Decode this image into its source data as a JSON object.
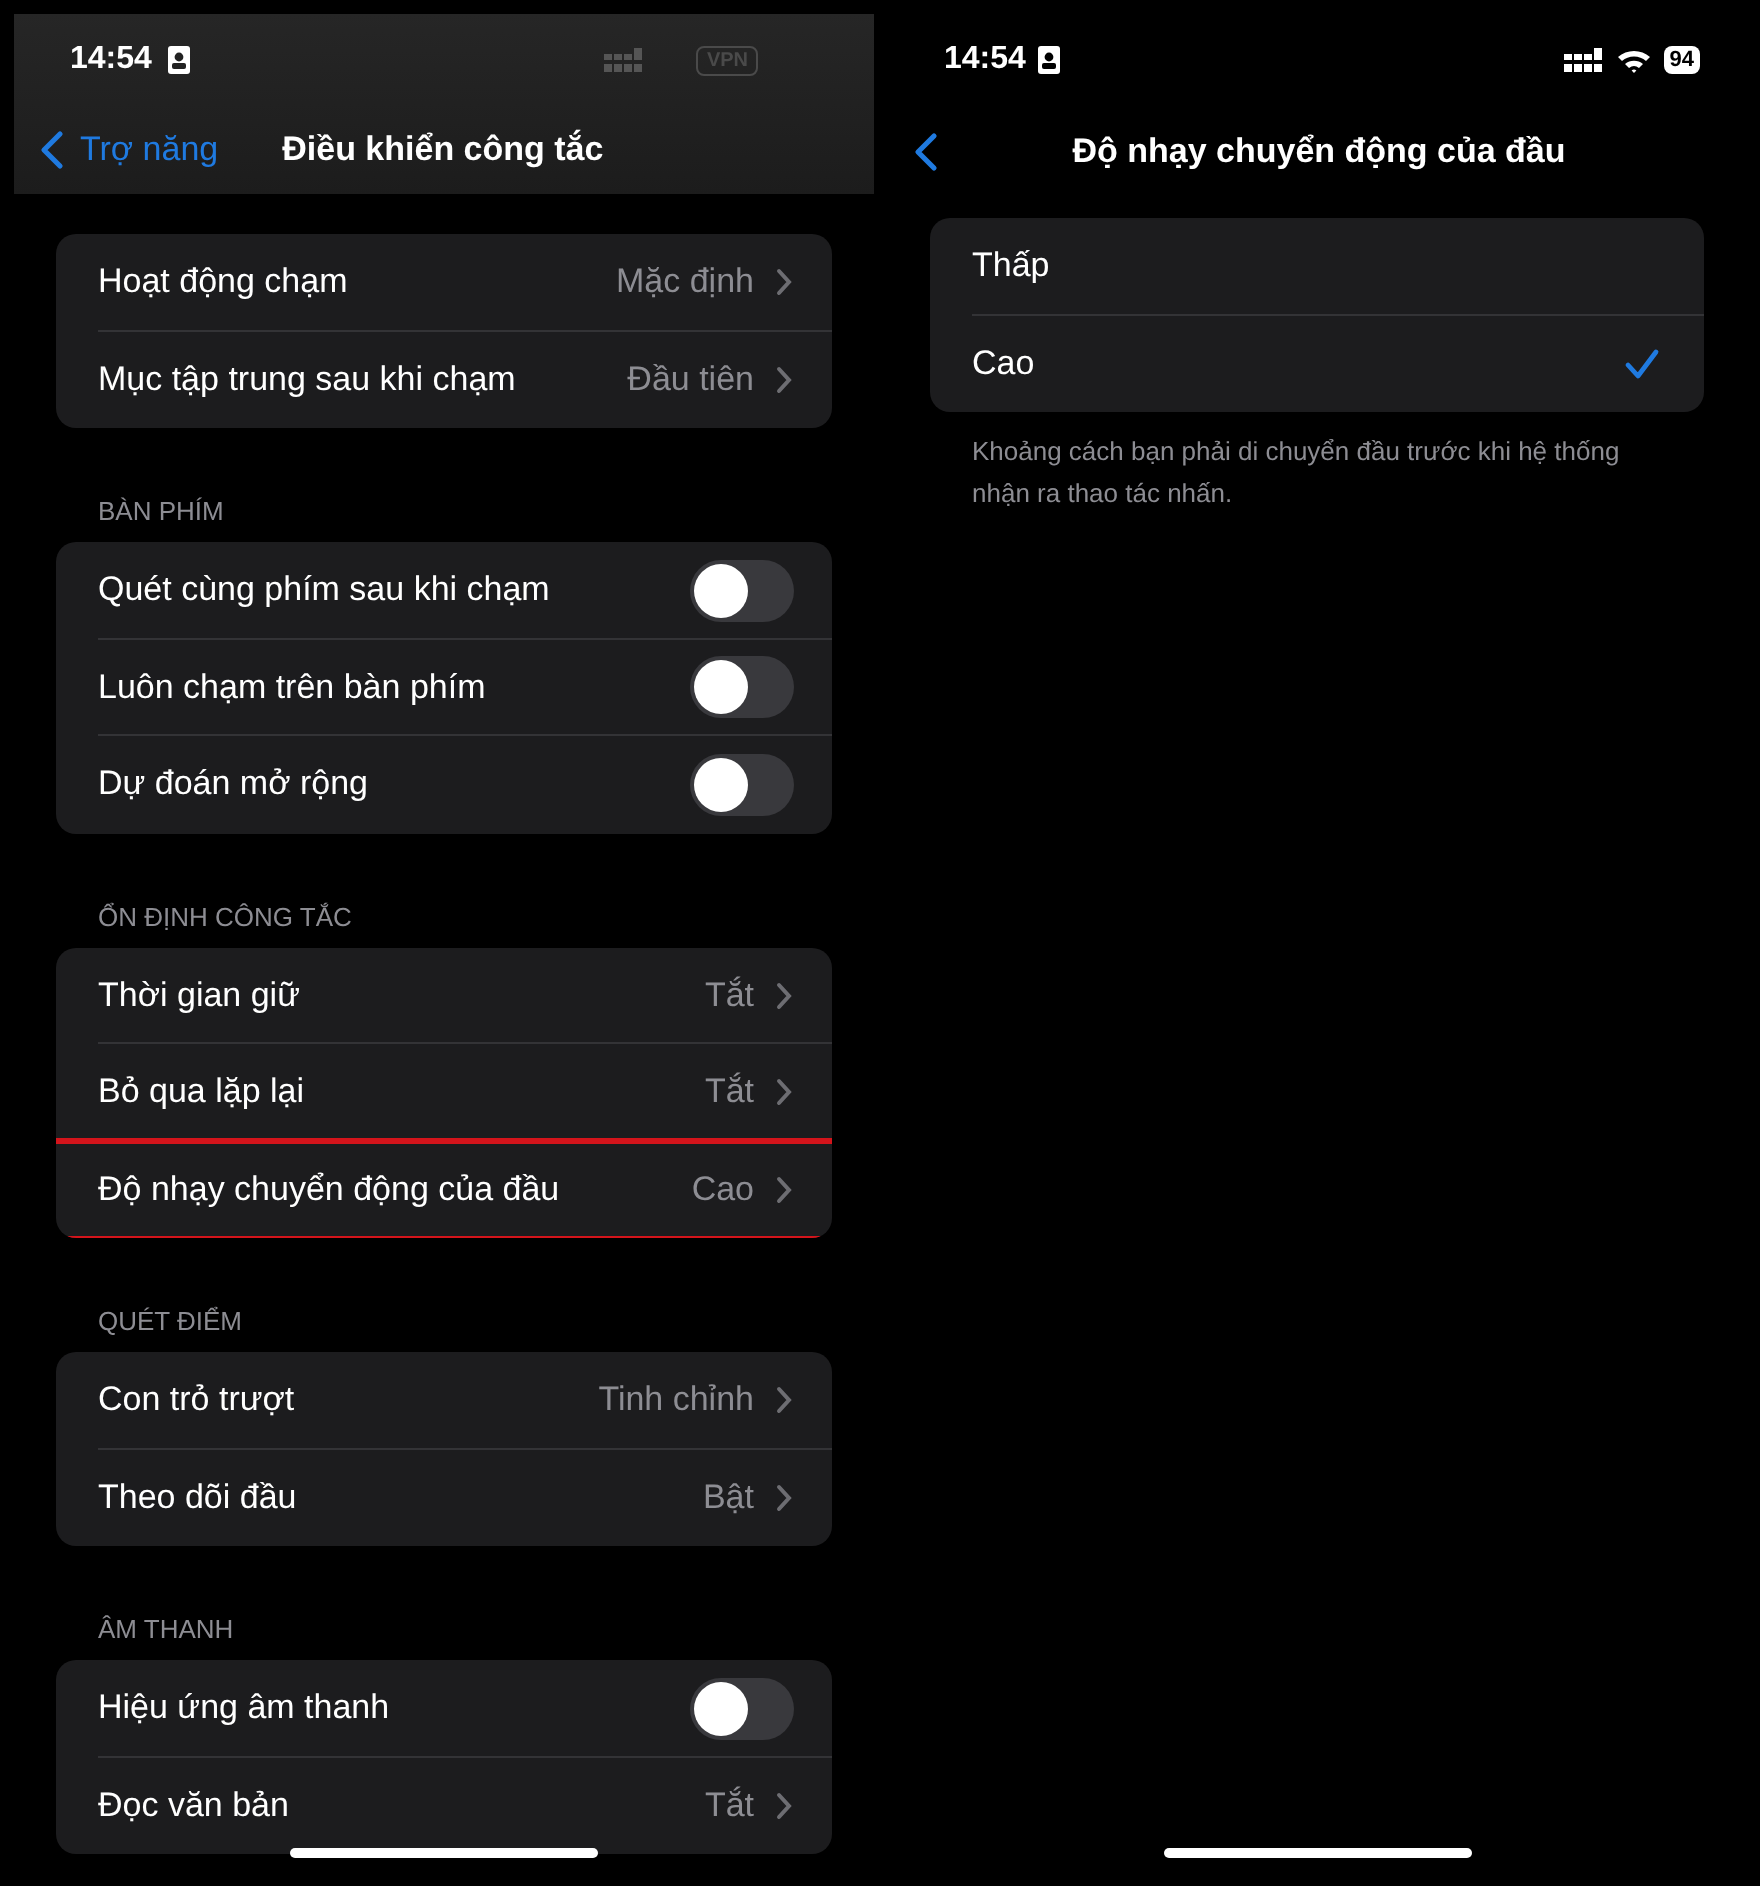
{
  "left": {
    "status_bar": {
      "time": "14:54",
      "vpn": "VPN"
    },
    "nav": {
      "back_label": "Trợ năng",
      "title": "Điều khiển công tắc"
    },
    "sections": [
      {
        "rows": [
          {
            "kind": "value",
            "label": "Hoạt động chạm",
            "value": "Mặc định",
            "highlighted": false
          },
          {
            "kind": "value",
            "label": "Mục tập trung sau khi chạm",
            "value": "Đầu tiên",
            "highlighted": false
          }
        ]
      },
      {
        "header": "BÀN PHÍM",
        "rows": [
          {
            "kind": "toggle",
            "label": "Quét cùng phím sau khi chạm",
            "on": false,
            "highlighted": false
          },
          {
            "kind": "toggle",
            "label": "Luôn chạm trên bàn phím",
            "on": false,
            "highlighted": false
          },
          {
            "kind": "toggle",
            "label": "Dự đoán mở rộng",
            "on": false,
            "highlighted": false
          }
        ]
      },
      {
        "header": "ỔN ĐỊNH CÔNG TẮC",
        "rows": [
          {
            "kind": "value",
            "label": "Thời gian giữ",
            "value": "Tắt",
            "highlighted": false
          },
          {
            "kind": "value",
            "label": "Bỏ qua lặp lại",
            "value": "Tắt",
            "highlighted": false
          },
          {
            "kind": "value",
            "label": "Độ nhạy chuyển động của đầu",
            "value": "Cao",
            "highlighted": true
          }
        ]
      },
      {
        "header": "QUÉT ĐIỂM",
        "rows": [
          {
            "kind": "value",
            "label": "Con trỏ trượt",
            "value": "Tinh chỉnh",
            "highlighted": false
          },
          {
            "kind": "value",
            "label": "Theo dõi đầu",
            "value": "Bật",
            "highlighted": false
          }
        ]
      },
      {
        "header": "ÂM THANH",
        "rows": [
          {
            "kind": "toggle",
            "label": "Hiệu ứng âm thanh",
            "on": false,
            "highlighted": false
          },
          {
            "kind": "value",
            "label": "Đọc văn bản",
            "value": "Tắt",
            "highlighted": false
          }
        ]
      }
    ]
  },
  "right": {
    "status_bar": {
      "time": "14:54",
      "battery": "94"
    },
    "nav": {
      "title": "Độ nhạy chuyển động của đầu"
    },
    "options": [
      {
        "label": "Thấp",
        "selected": false
      },
      {
        "label": "Cao",
        "selected": true
      }
    ],
    "footer": "Khoảng cách bạn phải di chuyển đầu trước khi hệ thống nhận ra thao tác nhấn."
  }
}
